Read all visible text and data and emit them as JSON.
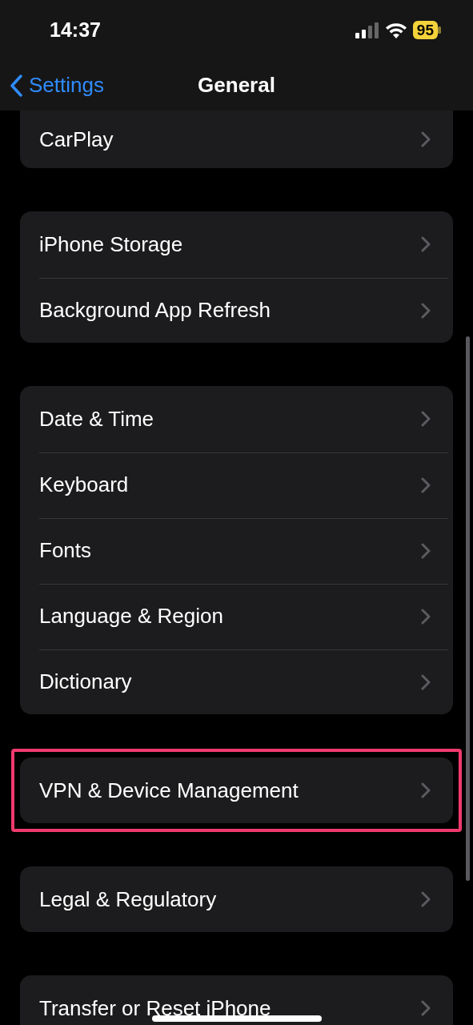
{
  "status_bar": {
    "time": "14:37",
    "battery": "95",
    "low_power": true
  },
  "nav": {
    "back": "Settings",
    "title": "General"
  },
  "groups": [
    {
      "highlighted": false,
      "items": [
        {
          "label": "CarPlay"
        }
      ]
    },
    {
      "highlighted": false,
      "items": [
        {
          "label": "iPhone Storage"
        },
        {
          "label": "Background App Refresh"
        }
      ]
    },
    {
      "highlighted": false,
      "items": [
        {
          "label": "Date & Time"
        },
        {
          "label": "Keyboard"
        },
        {
          "label": "Fonts"
        },
        {
          "label": "Language & Region"
        },
        {
          "label": "Dictionary"
        }
      ]
    },
    {
      "highlighted": true,
      "items": [
        {
          "label": "VPN & Device Management"
        }
      ]
    },
    {
      "highlighted": false,
      "items": [
        {
          "label": "Legal & Regulatory"
        }
      ]
    },
    {
      "highlighted": false,
      "items": [
        {
          "label": "Transfer or Reset iPhone"
        }
      ]
    }
  ]
}
